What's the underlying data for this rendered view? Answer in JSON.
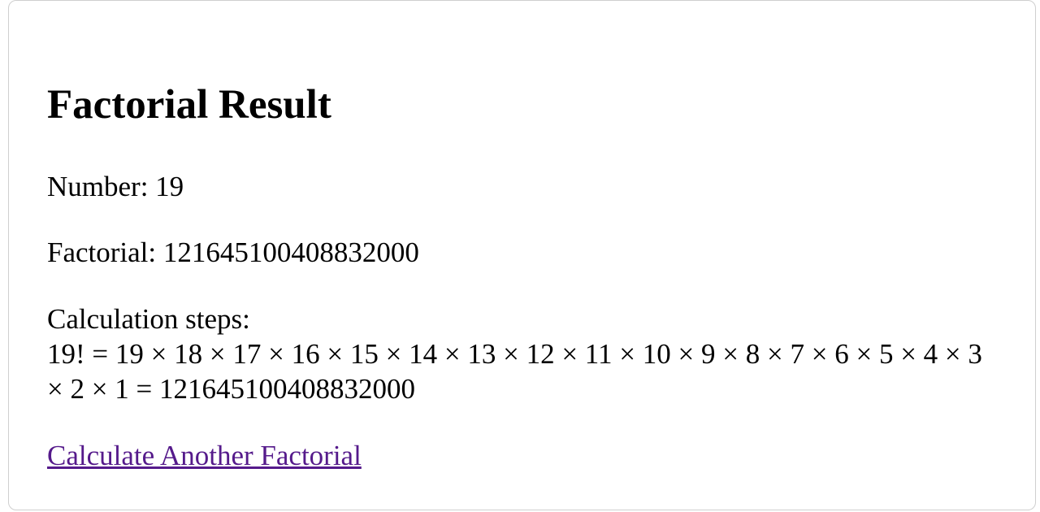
{
  "result": {
    "title": "Factorial Result",
    "number_line": "Number: 19",
    "factorial_line": "Factorial: 121645100408832000",
    "steps_label": "Calculation steps:",
    "steps_expression": "19! = 19 × 18 × 17 × 16 × 15 × 14 × 13 × 12 × 11 × 10 × 9 × 8 × 7 × 6 × 5 × 4 × 3 × 2 × 1 = 121645100408832000",
    "link_label": "Calculate Another Factorial",
    "link_color": "#551a8b"
  }
}
